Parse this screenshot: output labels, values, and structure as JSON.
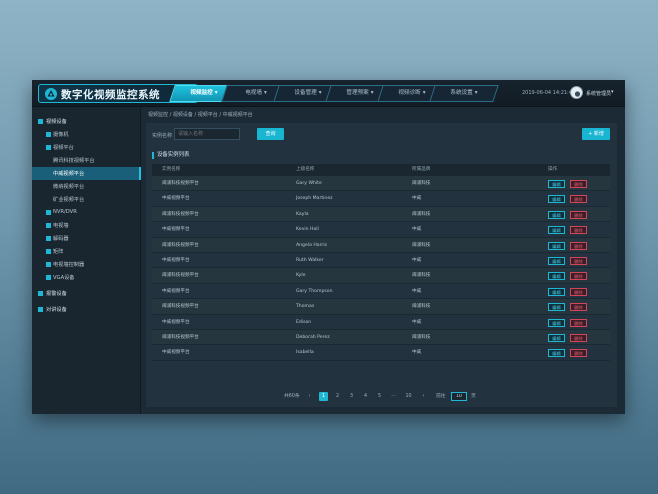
{
  "app": {
    "title": "数字化视频监控系统",
    "accent": "#1fb7d4",
    "datetime": "2019-06-04 14:21:40",
    "user_name": "系统管理员"
  },
  "nav": [
    {
      "label": "视频监控",
      "active": true
    },
    {
      "label": "电视墙",
      "active": false
    },
    {
      "label": "设备管理",
      "active": false
    },
    {
      "label": "管理预案",
      "active": false
    },
    {
      "label": "视频诊断",
      "active": false
    },
    {
      "label": "系统设置",
      "active": false
    }
  ],
  "sidebar": [
    {
      "label": "视频设备",
      "level": 0
    },
    {
      "label": "摄像机",
      "level": 1
    },
    {
      "label": "视频平台",
      "level": 1
    },
    {
      "label": "腾讯科技视频平台",
      "level": 2
    },
    {
      "label": "中威视频平台",
      "level": 2,
      "active": true
    },
    {
      "label": "微纳视频平台",
      "level": 2
    },
    {
      "label": "矿业视频平台",
      "level": 2
    },
    {
      "label": "NVR/DVR",
      "level": 1
    },
    {
      "label": "电视墙",
      "level": 1
    },
    {
      "label": "解码器",
      "level": 1
    },
    {
      "label": "矩阵",
      "level": 1
    },
    {
      "label": "电视墙控制器",
      "level": 1
    },
    {
      "label": "VGA设备",
      "level": 1
    },
    {
      "label": "报警设备",
      "level": 0
    },
    {
      "label": "对讲设备",
      "level": 0
    }
  ],
  "breadcrumb": "视频监控  /  视频设备  /  视频平台  /  中威视频平台",
  "filter": {
    "label": "实例名称",
    "placeholder": "请输入名称",
    "query_label": "查询",
    "add_label": "+  新增"
  },
  "section_title": "设备实例列表",
  "table": {
    "headers": [
      "实例名称",
      "上级名称",
      "所属品牌",
      "操作"
    ],
    "edit_label": "编辑",
    "delete_label": "删除",
    "rows": [
      [
        "闽浦科技视频平台",
        "Gary White",
        "闽浦科技"
      ],
      [
        "中威视频平台",
        "Joseph Martinez",
        "中威"
      ],
      [
        "闽浦科技视频平台",
        "Kayla",
        "闽浦科技"
      ],
      [
        "中威视频平台",
        "Kevin Hall",
        "中威"
      ],
      [
        "闽浦科技视频平台",
        "Angela Harris",
        "闽浦科技"
      ],
      [
        "中威视频平台",
        "Ruth Walker",
        "中威"
      ],
      [
        "闽浦科技视频平台",
        "Kyle",
        "闽浦科技"
      ],
      [
        "中威视频平台",
        "Gary Thompson",
        "中威"
      ],
      [
        "闽浦科技视频平台",
        "Thomas",
        "闽浦科技"
      ],
      [
        "中威视频平台",
        "Edison",
        "中威"
      ],
      [
        "闽浦科技视频平台",
        "Deborah Perez",
        "闽浦科技"
      ],
      [
        "中威视频平台",
        "Isabella",
        "中威"
      ]
    ]
  },
  "pagination": {
    "total_label": "共60条",
    "prev": "‹",
    "pages": [
      "1",
      "2",
      "3",
      "4",
      "5",
      "···",
      "10"
    ],
    "current": "1",
    "next": "›",
    "goto_label": "前往",
    "goto_value": "10",
    "page_unit": "页"
  }
}
